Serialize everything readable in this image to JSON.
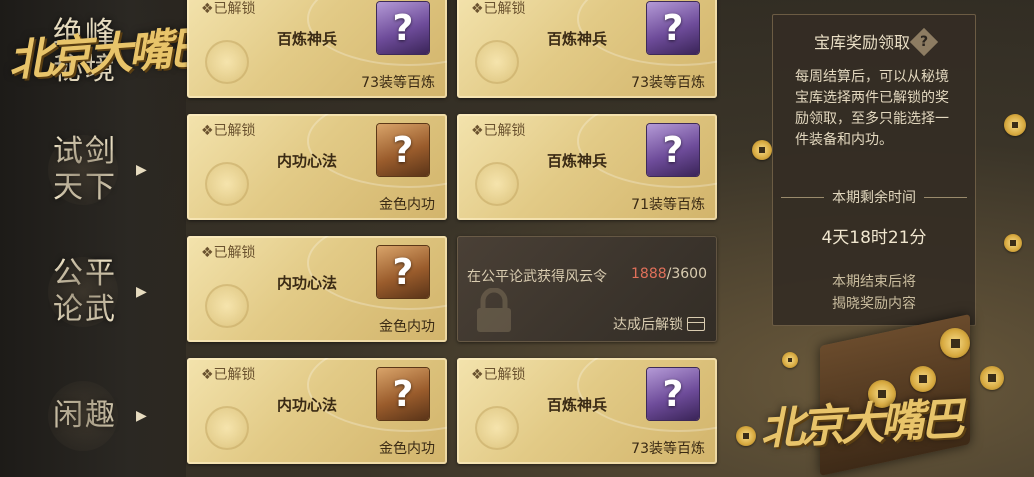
{
  "logo_text": "北京大嘴巴",
  "watermark_text": "北京大嘴巴",
  "nav": [
    {
      "label": "绝峰秘境"
    },
    {
      "label": "试剑天下"
    },
    {
      "label": "公平论武"
    },
    {
      "label": "闲趣"
    }
  ],
  "cards": [
    {
      "status": "❖已解锁",
      "name": "百炼神兵",
      "tile_icon": "?",
      "sub": "73装等百炼",
      "color": "purple"
    },
    {
      "status": "❖已解锁",
      "name": "百炼神兵",
      "tile_icon": "?",
      "sub": "73装等百炼",
      "color": "purple"
    },
    {
      "status": "❖已解锁",
      "name": "内功心法",
      "tile_icon": "?",
      "sub": "金色内功",
      "color": "orange"
    },
    {
      "status": "❖已解锁",
      "name": "百炼神兵",
      "tile_icon": "?",
      "sub": "71装等百炼",
      "color": "purple"
    },
    {
      "status": "❖已解锁",
      "name": "内功心法",
      "tile_icon": "?",
      "sub": "金色内功",
      "color": "orange"
    },
    {
      "status": "❖已解锁",
      "name": "内功心法",
      "tile_icon": "?",
      "sub": "金色内功",
      "color": "orange"
    },
    {
      "status": "❖已解锁",
      "name": "百炼神兵",
      "tile_icon": "?",
      "sub": "73装等百炼",
      "color": "purple"
    }
  ],
  "locked_card": {
    "text": "在公平论武获得风云令",
    "progress_current": "1888",
    "progress_total": "/3600",
    "hint": "达成后解锁"
  },
  "panel": {
    "title": "宝库奖励领取",
    "help_icon": "?",
    "desc": "每周结算后，可以从秘境宝库选择两件已解锁的奖励领取，至多只能选择一件装备和内功。",
    "timer_label": "本期剩余时间",
    "timer_value": "4天18时21分",
    "note_line1": "本期结束后将",
    "note_line2": "揭晓奖励内容"
  },
  "colors": {
    "gold": "#e8c46a",
    "card_bg": "#e2ca86",
    "panel_bg": "#342c24",
    "progress": "#e0705a"
  }
}
